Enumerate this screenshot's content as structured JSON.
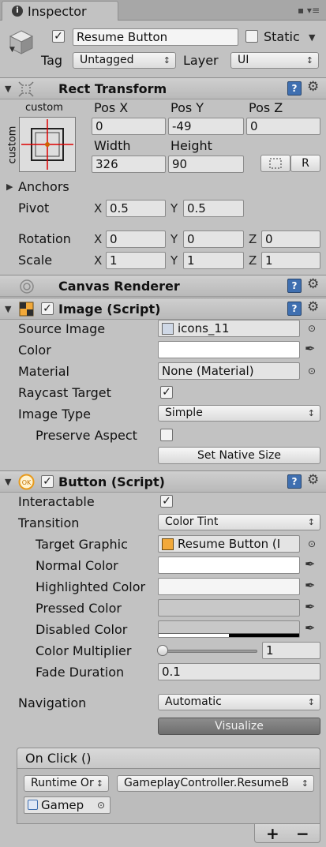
{
  "window": {
    "tab_title": "Inspector",
    "tab_icon": "i",
    "tab_menu": "▪ ▾≡"
  },
  "object": {
    "active": true,
    "name": "Resume Button",
    "static_label": "Static",
    "static_checked": false,
    "tag_label": "Tag",
    "tag_value": "Untagged",
    "layer_label": "Layer",
    "layer_value": "UI"
  },
  "rect_transform": {
    "title": "Rect Transform",
    "anchor_preset_top": "custom",
    "anchor_preset_side": "custom",
    "pos_x_label": "Pos X",
    "pos_y_label": "Pos Y",
    "pos_z_label": "Pos Z",
    "pos_x": "0",
    "pos_y": "-49",
    "pos_z": "0",
    "width_label": "Width",
    "height_label": "Height",
    "width": "326",
    "height": "90",
    "raw_edit_label": "R",
    "anchors_label": "Anchors",
    "pivot_label": "Pivot",
    "pivot_x": "0.5",
    "pivot_y": "0.5",
    "rotation_label": "Rotation",
    "rot_x": "0",
    "rot_y": "0",
    "rot_z": "0",
    "scale_label": "Scale",
    "scale_x": "1",
    "scale_y": "1",
    "scale_z": "1",
    "axis_x": "X",
    "axis_y": "Y",
    "axis_z": "Z"
  },
  "canvas_renderer": {
    "title": "Canvas Renderer"
  },
  "image": {
    "title": "Image (Script)",
    "enabled": true,
    "source_image_label": "Source Image",
    "source_image": "icons_11",
    "color_label": "Color",
    "material_label": "Material",
    "material": "None (Material)",
    "raycast_label": "Raycast Target",
    "raycast": true,
    "image_type_label": "Image Type",
    "image_type": "Simple",
    "preserve_label": "Preserve Aspect",
    "preserve": false,
    "native_size_button": "Set Native Size"
  },
  "button": {
    "title": "Button (Script)",
    "enabled": true,
    "interactable_label": "Interactable",
    "interactable": true,
    "transition_label": "Transition",
    "transition": "Color Tint",
    "target_graphic_label": "Target Graphic",
    "target_graphic": "Resume Button (I",
    "normal_color_label": "Normal Color",
    "highlighted_color_label": "Highlighted Color",
    "pressed_color_label": "Pressed Color",
    "disabled_color_label": "Disabled Color",
    "multiplier_label": "Color Multiplier",
    "multiplier": "1",
    "multiplier_fraction": 0.0,
    "fade_label": "Fade Duration",
    "fade": "0.1",
    "navigation_label": "Navigation",
    "navigation": "Automatic",
    "visualize_button": "Visualize"
  },
  "on_click": {
    "title": "On Click ()",
    "runtime": "Runtime Or",
    "function": "GameplayController.ResumeB",
    "object": "Gamep",
    "add_label": "+",
    "remove_label": "−"
  },
  "colors": {
    "panel": "#c2c2c2",
    "normal": "#ffffff",
    "highlighted": "#f5f5f5",
    "pressed": "#c8c8c8",
    "disabled": "#c8c8c8"
  },
  "icons": {
    "help": "?",
    "gear": "⚙",
    "check": "✓",
    "picker": "⊙",
    "eyedropper": "✒",
    "foldout_open": "▼",
    "foldout_closed": "▶"
  }
}
